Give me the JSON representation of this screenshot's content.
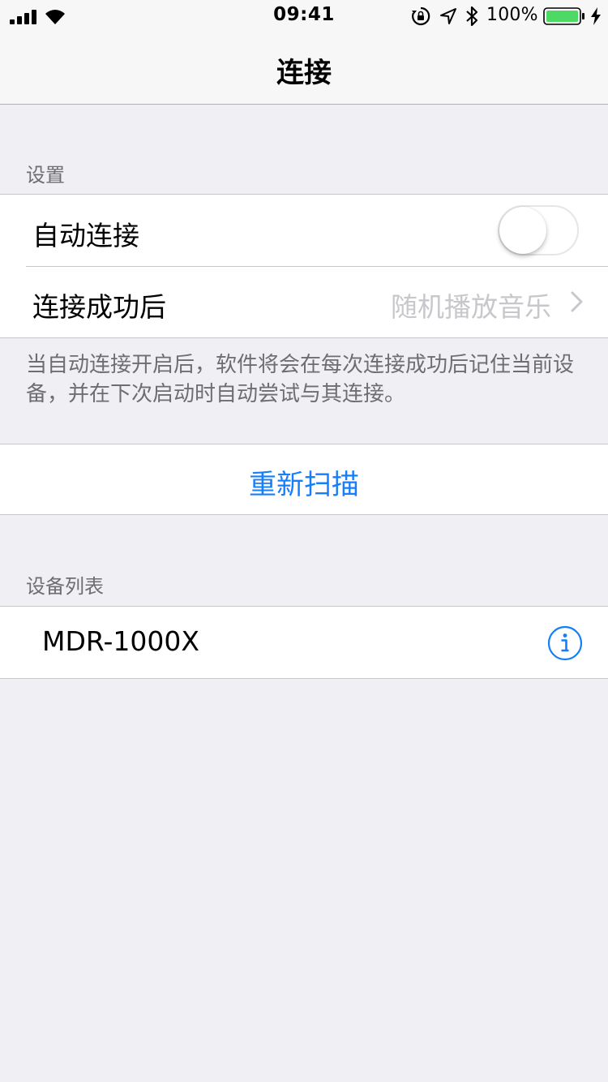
{
  "status_bar": {
    "time": "09:41",
    "battery_percent": "100%",
    "battery_level": 1.0,
    "icons": [
      "signal-icon",
      "wifi-icon",
      "rotation-lock-icon",
      "location-icon",
      "bluetooth-icon",
      "battery-icon",
      "charging-icon"
    ]
  },
  "nav": {
    "title": "连接"
  },
  "settings_section": {
    "header": "设置",
    "auto_connect": {
      "label": "自动连接",
      "enabled": false
    },
    "after_connect": {
      "label": "连接成功后",
      "value": "随机播放音乐"
    },
    "footer": "当自动连接开启后，软件将会在每次连接成功后记住当前设备，并在下次启动时自动尝试与其连接。"
  },
  "rescan": {
    "label": "重新扫描"
  },
  "device_section": {
    "header": "设备列表",
    "devices": [
      {
        "name": "MDR-1000X"
      }
    ]
  },
  "colors": {
    "accent": "#147efb",
    "background": "#efeff4",
    "battery_fill": "#4cd964",
    "secondary_text": "#6d6d72",
    "value_text": "#c7c7cc"
  }
}
